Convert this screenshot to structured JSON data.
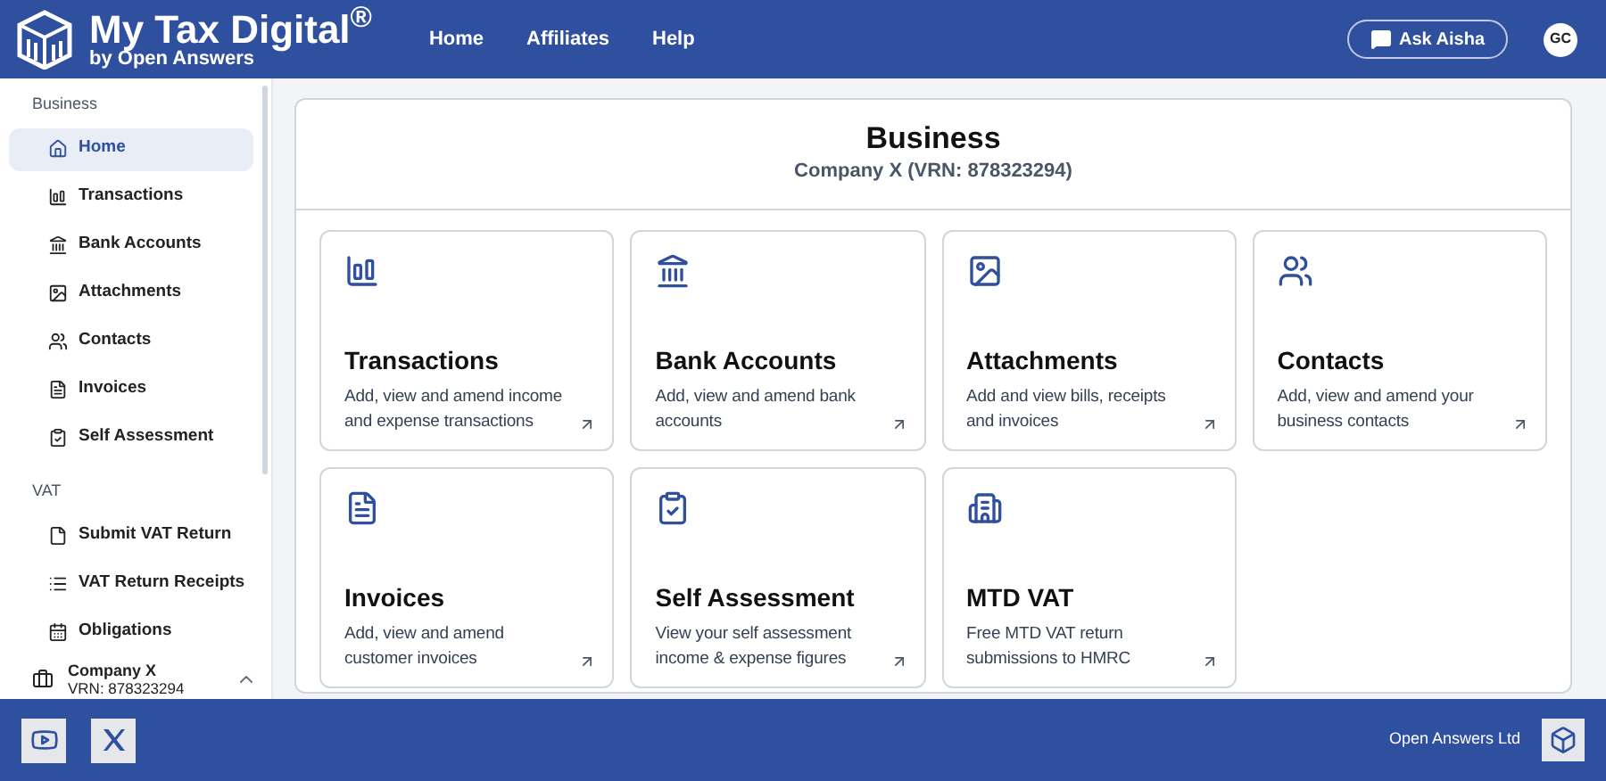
{
  "header": {
    "brand": "My Tax Digital$^{®}$",
    "tagline": "by Open Answers",
    "nav": [
      {
        "label": "Home"
      },
      {
        "label": "Affiliates"
      },
      {
        "label": "Help"
      }
    ],
    "assistant_button": "Ask Aisha",
    "avatar": "GC"
  },
  "sidebar": {
    "sections": [
      {
        "title": "Business",
        "items": [
          {
            "label": "Home",
            "kind": "home",
            "selected": true
          },
          {
            "label": "Transactions",
            "kind": "chart",
            "selected": false
          },
          {
            "label": "Bank Accounts",
            "kind": "bank",
            "selected": false
          },
          {
            "label": "Attachments",
            "kind": "image",
            "selected": false
          },
          {
            "label": "Contacts",
            "kind": "people",
            "selected": false
          },
          {
            "label": "Invoices",
            "kind": "doc",
            "selected": false
          },
          {
            "label": "Self Assessment",
            "kind": "check",
            "selected": false
          }
        ]
      },
      {
        "title": "VAT",
        "items": [
          {
            "label": "Submit VAT Return",
            "kind": "file",
            "selected": false
          },
          {
            "label": "VAT Return Receipts",
            "kind": "list",
            "selected": false
          },
          {
            "label": "Obligations",
            "kind": "calendar",
            "selected": false
          }
        ]
      }
    ],
    "company": {
      "name": "Company X",
      "vrn": "VRN: 878323294"
    }
  },
  "main": {
    "title": "Business",
    "subtitle": "Company X (VRN: 878323294)",
    "cards": [
      {
        "kind": "chart",
        "title": "Transactions",
        "description": "Add, view and amend income and expense transactions"
      },
      {
        "kind": "bank",
        "title": "Bank Accounts",
        "description": "Add, view and amend bank accounts"
      },
      {
        "kind": "image",
        "title": "Attachments",
        "description": "Add and view bills, receipts and invoices"
      },
      {
        "kind": "people",
        "title": "Contacts",
        "description": "Add, view and amend your business contacts"
      },
      {
        "kind": "doc",
        "title": "Invoices",
        "description": "Add, view and amend customer invoices"
      },
      {
        "kind": "check",
        "title": "Self Assessment",
        "description": "View your self assessment income & expense figures"
      },
      {
        "kind": "building",
        "title": "MTD VAT",
        "description": "Free MTD VAT return submissions to HMRC"
      }
    ]
  },
  "footer": {
    "company": "Open Answers Ltd"
  }
}
